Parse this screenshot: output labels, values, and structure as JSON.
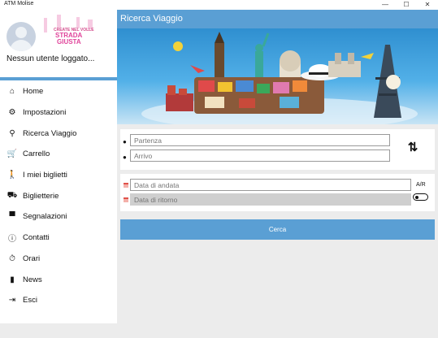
{
  "window": {
    "title": "ATM Molise",
    "minimize_glyph": "—",
    "maximize_glyph": "☐",
    "close_glyph": "✕"
  },
  "profile": {
    "username": "Nessun utente loggato...",
    "logo_text": {
      "line1": "CREATE NEL VOLLE",
      "line2": "STRADA",
      "line3": "GIUSTA"
    }
  },
  "sidebar": {
    "items": [
      {
        "label": "Home",
        "icon": "home-icon",
        "glyph": "⌂"
      },
      {
        "label": "Impostazioni",
        "icon": "settings-icon",
        "glyph": "⚙"
      },
      {
        "label": "Ricerca Viaggio",
        "icon": "search-icon",
        "glyph": "⚲"
      },
      {
        "label": "Carrello",
        "icon": "cart-icon",
        "glyph": "🛒"
      },
      {
        "label": "I miei biglietti",
        "icon": "walking-person-icon",
        "glyph": "🚶"
      },
      {
        "label": "Biglietterie",
        "icon": "ticket-office-icon",
        "glyph": "⛟"
      },
      {
        "label": "Segnalazioni",
        "icon": "message-icon",
        "glyph": "▀"
      },
      {
        "label": "Contatti",
        "icon": "info-icon",
        "glyph": "ⓘ"
      },
      {
        "label": "Orari",
        "icon": "clock-icon",
        "glyph": "⏱"
      },
      {
        "label": "News",
        "icon": "document-icon",
        "glyph": "▮"
      },
      {
        "label": "Esci",
        "icon": "logout-icon",
        "glyph": "⇥"
      }
    ]
  },
  "main": {
    "title": "Ricerca Viaggio",
    "departure_placeholder": "Partenza",
    "arrival_placeholder": "Arrivo",
    "outbound_date_placeholder": "Data di andata",
    "return_date_placeholder": "Data di ritorno",
    "round_trip_label": "A/R",
    "swap_glyph": "⇅",
    "search_button": "Cerca"
  },
  "colors": {
    "accent": "#5a9fd4",
    "background": "#ececec",
    "card": "#ffffff",
    "calendar_icon": "#e0524a"
  }
}
